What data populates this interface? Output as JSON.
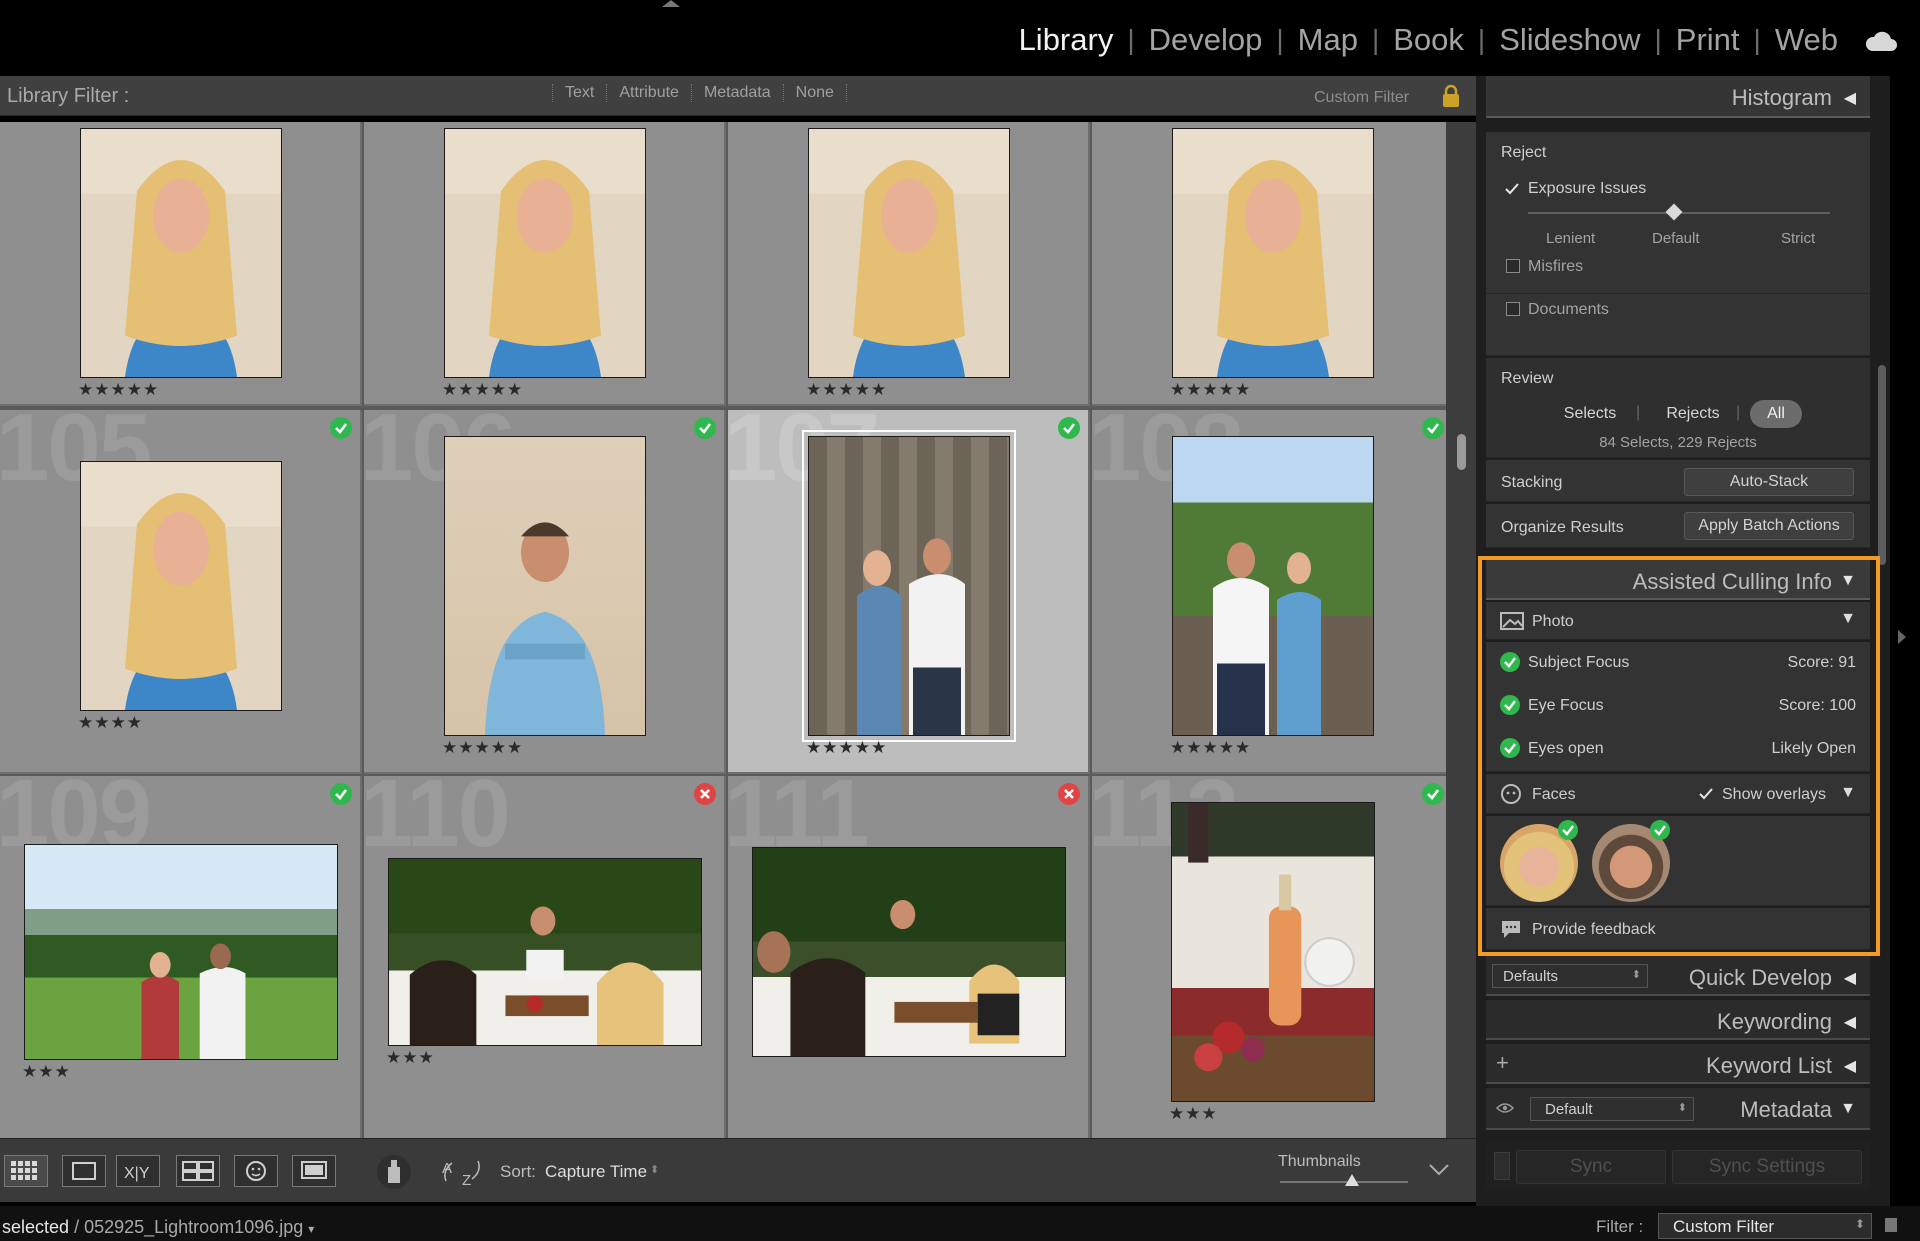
{
  "modules": [
    "Library",
    "Develop",
    "Map",
    "Book",
    "Slideshow",
    "Print",
    "Web"
  ],
  "active_module": "Library",
  "filter_bar": {
    "title": "Library Filter :",
    "options": [
      "Text",
      "Attribute",
      "Metadata",
      "None"
    ],
    "custom_filter": "Custom Filter"
  },
  "grid": {
    "cells": [
      {
        "num": "",
        "stars": "★★★★★",
        "flag": "",
        "kind": "portrait-woman"
      },
      {
        "num": "",
        "stars": "★★★★★",
        "flag": "",
        "kind": "portrait-woman"
      },
      {
        "num": "",
        "stars": "★★★★★",
        "flag": "",
        "kind": "portrait-woman"
      },
      {
        "num": "",
        "stars": "★★★★★",
        "flag": "",
        "kind": "portrait-woman"
      },
      {
        "num": "105",
        "stars": "★★★★",
        "flag": "pick",
        "kind": "portrait-woman"
      },
      {
        "num": "106",
        "stars": "★★★★★",
        "flag": "pick",
        "kind": "portrait-man"
      },
      {
        "num": "107",
        "stars": "★★★★★",
        "flag": "pick",
        "kind": "couple-wall",
        "selected": true
      },
      {
        "num": "108",
        "stars": "★★★★★",
        "flag": "pick",
        "kind": "couple-outdoor"
      },
      {
        "num": "109",
        "stars": "★★★",
        "flag": "pick",
        "kind": "vineyard"
      },
      {
        "num": "110",
        "stars": "★★★",
        "flag": "reject",
        "kind": "dinner"
      },
      {
        "num": "111",
        "stars": "",
        "flag": "reject",
        "kind": "dinner2"
      },
      {
        "num": "112",
        "stars": "★★★",
        "flag": "pick",
        "kind": "table-food"
      }
    ]
  },
  "toolbar": {
    "sort_label": "Sort:",
    "sort_value": "Capture Time",
    "thumbnails_label": "Thumbnails",
    "thumbnails_level": 0.5
  },
  "status": {
    "selected": "selected",
    "path": "/ 052925_Lightroom1096.jpg",
    "filter_label": "Filter :",
    "filter_value": "Custom Filter"
  },
  "panel": {
    "histogram": "Histogram",
    "reject": {
      "title": "Reject",
      "exposure": "Exposure Issues",
      "exposure_checked": true,
      "slider_left": "Lenient",
      "slider_mid": "Default",
      "slider_right": "Strict",
      "slider_level": 0.5,
      "misfires": "Misfires",
      "documents": "Documents"
    },
    "review": {
      "title": "Review",
      "selects": "Selects",
      "rejects": "Rejects",
      "all": "All",
      "summary": "84 Selects, 229 Rejects"
    },
    "stacking": {
      "label": "Stacking",
      "button": "Auto-Stack"
    },
    "organize": {
      "label": "Organize Results",
      "button": "Apply Batch Actions"
    },
    "aci": {
      "title": "Assisted Culling Info",
      "photo": "Photo",
      "rows": [
        {
          "label": "Subject Focus",
          "value": "Score: 91"
        },
        {
          "label": "Eye Focus",
          "value": "Score: 100"
        },
        {
          "label": "Eyes open",
          "value": "Likely Open"
        }
      ],
      "faces": "Faces",
      "show_overlays": "Show overlays",
      "feedback": "Provide feedback"
    },
    "quick_develop": {
      "title": "Quick Develop",
      "preset": "Defaults"
    },
    "keywording": "Keywording",
    "keyword_list": "Keyword List",
    "metadata": {
      "title": "Metadata",
      "preset": "Default"
    },
    "sync": "Sync",
    "sync_settings": "Sync Settings"
  },
  "colors": {
    "accent_orange": "#f29b26",
    "pick_green": "#2fb84d",
    "reject_red": "#e04545"
  }
}
